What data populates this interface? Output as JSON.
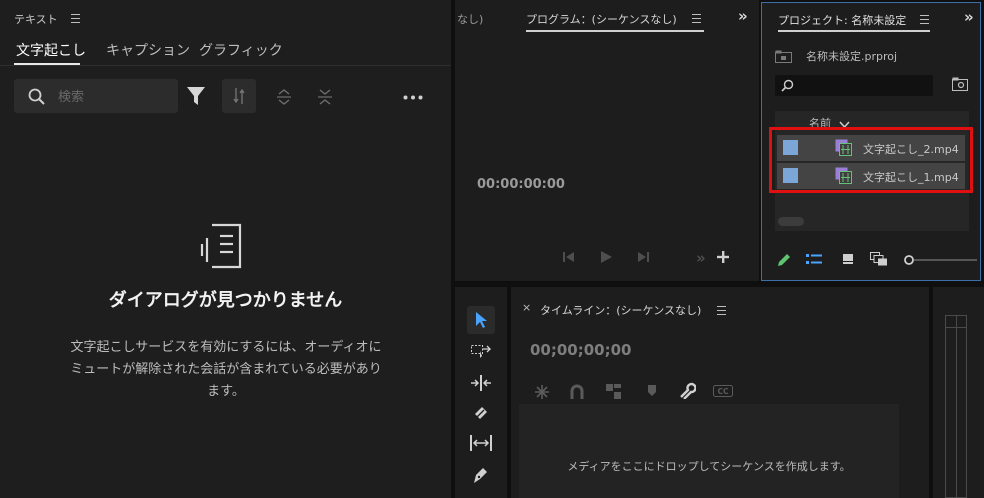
{
  "text_panel": {
    "title": "テキスト",
    "tabs": [
      {
        "label": "文字起こし"
      },
      {
        "label": "キャプション"
      },
      {
        "label": "グラフィック"
      }
    ],
    "search_placeholder": "検索",
    "empty_title": "ダイアログが見つかりません",
    "empty_desc_line1": "文字起こしサービスを有効にするには、オーディオに",
    "empty_desc_line2": "ミュートが解除された会話が含まれている必要があり",
    "empty_desc_line3": "ます。"
  },
  "program_panel": {
    "left_tab_fragment": "なし)",
    "title": "プログラム：(シーケンスなし)",
    "timecode": "00:00:00:00"
  },
  "project_panel": {
    "title": "プロジェクト: 名称未設定",
    "file": "名称未設定.prproj",
    "column_name": "名前",
    "items": [
      {
        "name": "文字起こし_2.mp4"
      },
      {
        "name": "文字起こし_1.mp4"
      }
    ],
    "highlight_color": "#e01010",
    "chip_color": "#7ca6d8"
  },
  "timeline_panel": {
    "title": "タイムライン：(シーケンスなし)",
    "timecode": "00;00;00;00",
    "drop_message": "メディアをここにドロップしてシーケンスを作成します。"
  },
  "icons": {
    "chevrons": "»",
    "plus": "+"
  }
}
